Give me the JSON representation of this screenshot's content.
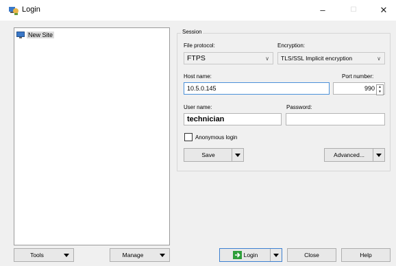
{
  "window": {
    "title": "Login",
    "minimize": "–",
    "maximize": "☐",
    "close": "✕"
  },
  "tree": {
    "items": [
      {
        "label": "New Site"
      }
    ]
  },
  "session": {
    "legend": "Session",
    "protocol_label": "File protocol:",
    "protocol_value": "FTPS",
    "encryption_label": "Encryption:",
    "encryption_value": "TLS/SSL Implicit encryption",
    "host_label": "Host name:",
    "host_value": "10.5.0.145",
    "port_label": "Port number:",
    "port_value": "990",
    "user_label": "User name:",
    "user_value": "technician",
    "password_label": "Password:",
    "password_value": "",
    "anon_label": "Anonymous login",
    "save_label": "Save",
    "advanced_label": "Advanced..."
  },
  "bottom": {
    "tools": "Tools",
    "manage": "Manage",
    "login": "Login",
    "close": "Close",
    "help": "Help"
  },
  "colors": {
    "focus": "#4a90d9",
    "login_icon": "#2e9e3a"
  }
}
